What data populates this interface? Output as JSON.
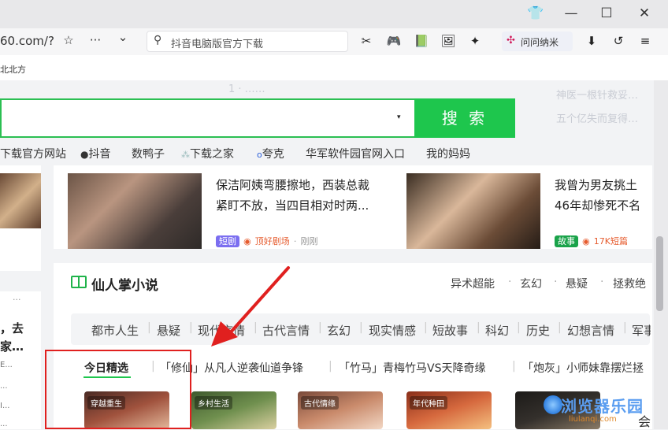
{
  "window": {
    "controls": [
      "👕",
      "—",
      "☐",
      "✕"
    ]
  },
  "nav": {
    "url": "60.com/?",
    "star": "☆",
    "more": "···",
    "chevron": "⌄",
    "search_placeholder": "抖音电脑版官方下载",
    "nami_label": "问问纳米",
    "toolbar_icons": [
      "✂",
      "🎮",
      "📗",
      "🖼",
      "✦",
      "⬇",
      "↺",
      "≡"
    ]
  },
  "bookmarks": {
    "first": "北北方"
  },
  "search": {
    "button_label": "搜 索",
    "dropdown": "▾"
  },
  "ghost_text": {
    "top1": "1  ·  ……",
    "right1": "神医一根针救妥…",
    "right2": "五个亿失而复得…"
  },
  "hotlinks": [
    "下载官方网站",
    "抖音",
    "数鸭子",
    "下载之家",
    "夸克",
    "华军软件园官网入口",
    "我的妈妈"
  ],
  "news": [
    {
      "title_line1": "保洁阿姨弯腰擦地，西装总裁",
      "title_line2": "紧盯不放，当四目相对时两...",
      "tag": "短剧",
      "tag_color": "#7b6ef0",
      "source": "顶好剧场",
      "time": "刚刚"
    },
    {
      "title_line1": "我曾为男友挑土",
      "title_line2": "46年却惨死不名",
      "tag": "故事",
      "tag_color": "#1aa34a",
      "source": "17K短篇",
      "time": ""
    }
  ],
  "left_snippets": {
    "dots": "···",
    "line1": "，去",
    "line2": "家…",
    "l3": "E...",
    "l4": "...",
    "l5": "I...",
    "l6": "..."
  },
  "novel": {
    "title": "仙人掌小说",
    "top_tags": [
      "异术超能",
      "玄幻",
      "悬疑",
      "拯救绝"
    ],
    "categories": [
      "都市人生",
      "悬疑",
      "现代言情",
      "古代言情",
      "玄幻",
      "现实情感",
      "短故事",
      "科幻",
      "历史",
      "幻想言情",
      "军事"
    ],
    "tabs": [
      "今日精选",
      "「修仙」从凡人逆袭仙道争锋",
      "「竹马」青梅竹马VS天降奇缘",
      "「炮灰」小师妹靠摆烂拯"
    ],
    "covers": [
      {
        "tag": "穿越重生",
        "color": "#a0523d"
      },
      {
        "tag": "乡村生活",
        "color": "#6f8f4e"
      },
      {
        "tag": "古代情缘",
        "color": "#c98a6b"
      },
      {
        "tag": "年代种田",
        "color": "#d6693e"
      },
      {
        "tag": "",
        "color": "#34302c"
      }
    ]
  },
  "watermark": {
    "main": "浏览器乐园",
    "sub": "liulanqi.com",
    "extra": "会"
  },
  "colors": {
    "accent_green": "#1ec64d",
    "highlight_red": "#e0201f"
  }
}
